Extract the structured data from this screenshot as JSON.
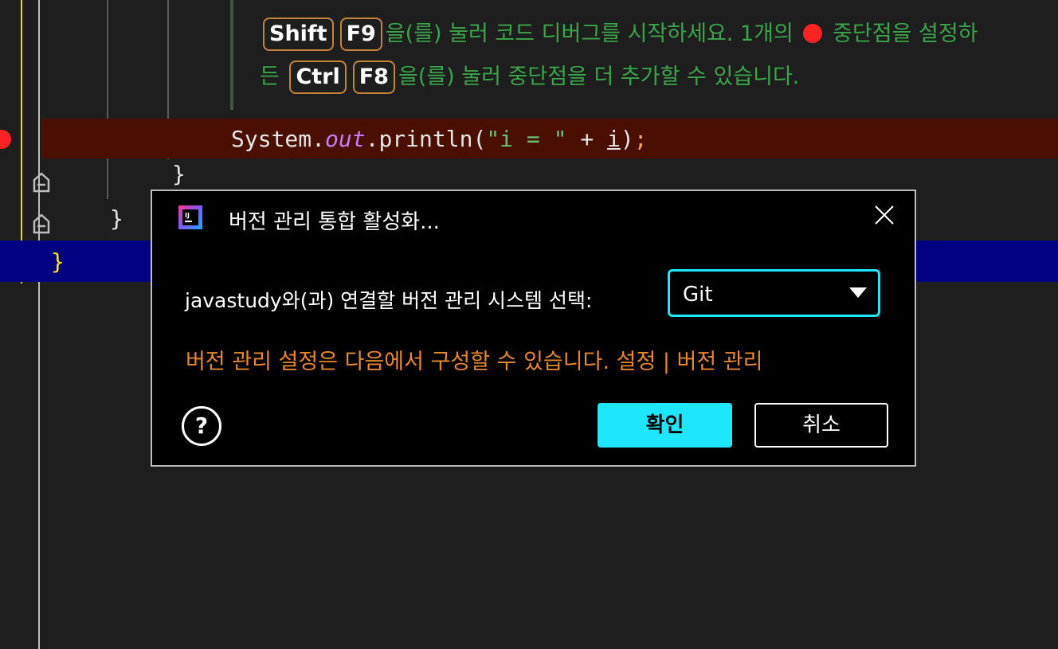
{
  "editor": {
    "hint_line1": {
      "key1": "Shift",
      "key2": "F9",
      "text_a": "을(를) 눌러 코드 디버그를 시작하세요. 1개의",
      "text_b": "중단점을 설정하"
    },
    "hint_line2": {
      "prefix": "든",
      "key1": "Ctrl",
      "key2": "F8",
      "text": "을(를) 눌러 중단점을 더 추가할 수 있습니다."
    },
    "code": {
      "obj": "System.",
      "field": "out",
      "call": ".println(",
      "str": "\"i = \"",
      "plus": " + ",
      "var": "i",
      "close": ")",
      "semi": ";"
    },
    "brace1": "}",
    "brace2": "}",
    "brace3": "}",
    "colors": {
      "breakpoint_bg": "#4a0f00",
      "current_line": "#000080",
      "hint_text": "#3aa64a"
    }
  },
  "dialog": {
    "title": "버전 관리 통합 활성화...",
    "app_icon": "intellij-icon",
    "prompt": "javastudy와(과) 연결할 버전 관리 시스템 선택:",
    "vcs_selected": "Git",
    "settings_note": "버전 관리 설정은 다음에서 구성할 수 있습니다. 설정 | 버전 관리",
    "help_label": "?",
    "ok_label": "확인",
    "cancel_label": "취소",
    "colors": {
      "accent": "#1ee6ff",
      "note": "#e8862b"
    }
  }
}
